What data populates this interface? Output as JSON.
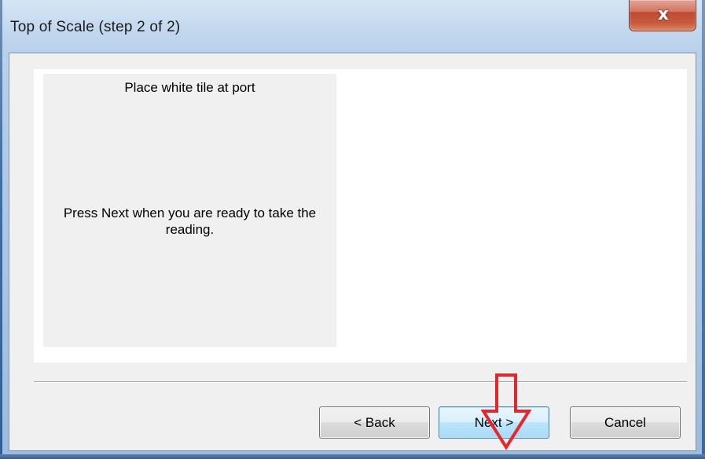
{
  "window": {
    "title": "Top of Scale (step 2 of 2)",
    "close_glyph": "x"
  },
  "panel": {
    "line1": "Place white tile at port",
    "line2": "Press Next when you are ready to take the reading."
  },
  "buttons": {
    "back": "< Back",
    "next": "Next >",
    "cancel": "Cancel"
  },
  "colors": {
    "annotation_arrow": "#e8262a",
    "close_button": "#c75a3c",
    "next_button_border": "#3c7fb1"
  },
  "icons": {
    "close": "close-icon",
    "annotation": "down-arrow-annotation-icon"
  }
}
